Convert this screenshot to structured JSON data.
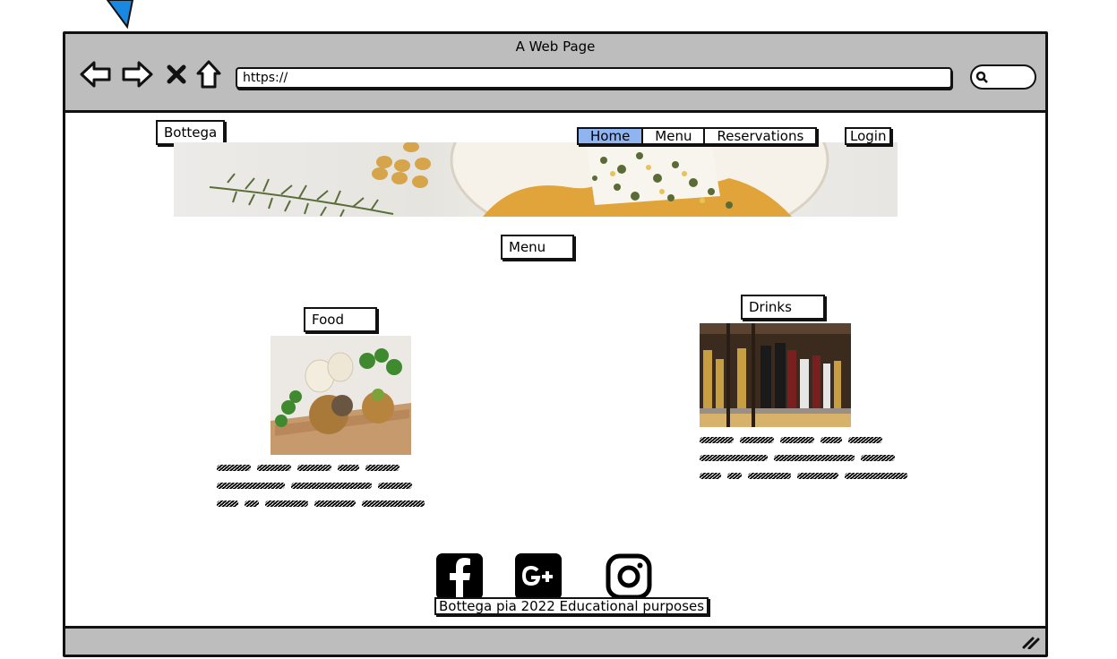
{
  "window": {
    "title": "A Web Page",
    "url": "https://"
  },
  "nav_icons": [
    "back-arrow-icon",
    "forward-arrow-icon",
    "stop-icon",
    "home-icon"
  ],
  "header": {
    "logo": "Bottega",
    "nav": [
      {
        "label": "Home",
        "active": true
      },
      {
        "label": "Menu",
        "active": false
      },
      {
        "label": "Reservations",
        "active": false
      }
    ],
    "login": "Login"
  },
  "main": {
    "section_title": "Menu",
    "cards": [
      {
        "title": "Food",
        "image": "food-photo"
      },
      {
        "title": "Drinks",
        "image": "drinks-photo"
      }
    ]
  },
  "footer": {
    "social": [
      "facebook-icon",
      "google-plus-icon",
      "instagram-icon"
    ],
    "text": "Bottega pia 2022 Educational purposes"
  },
  "colors": {
    "chrome": "#bdbdbd",
    "active_tab": "#8fb4f0",
    "pointer": "#1a88e0"
  }
}
